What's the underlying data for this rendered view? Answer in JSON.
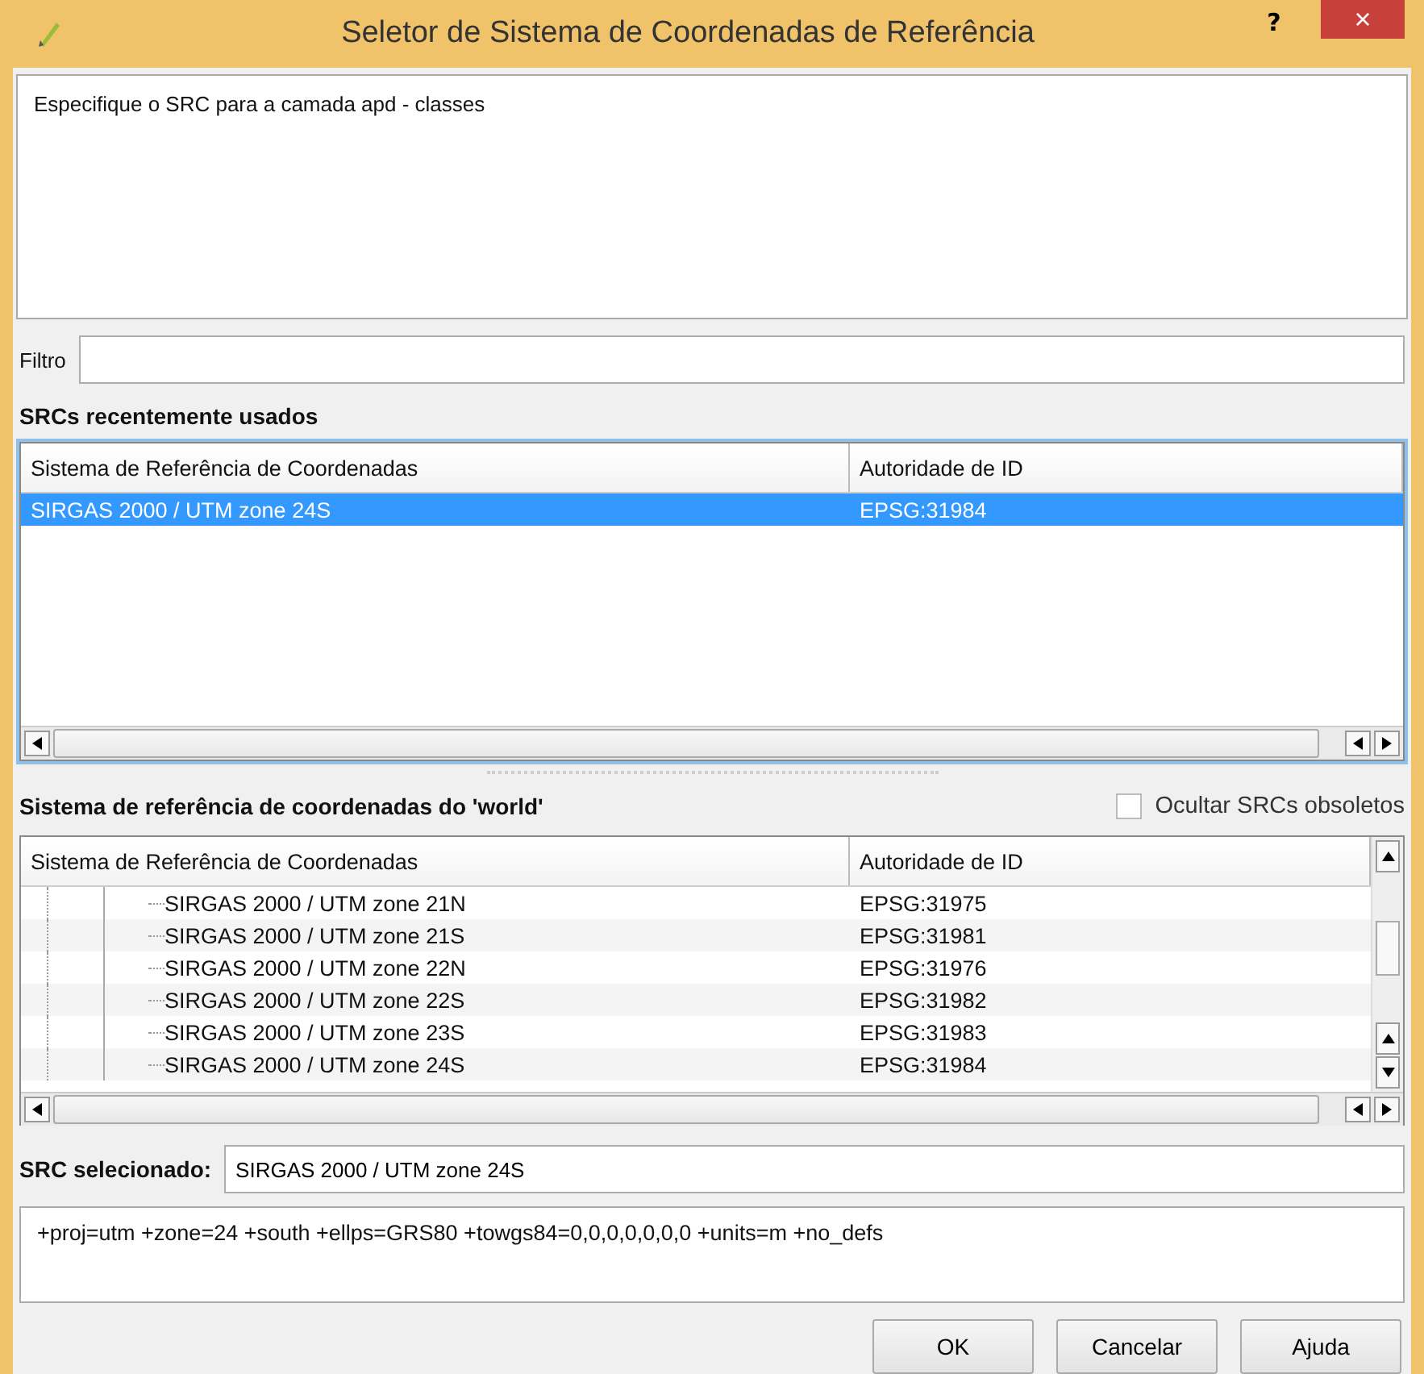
{
  "window": {
    "title": "Seletor de Sistema de Coordenadas de Referência",
    "help": "?",
    "close": "×"
  },
  "description": "Especifique o SRC para a camada apd - classes",
  "filter": {
    "label": "Filtro"
  },
  "recent": {
    "heading": "SRCs recentemente usados",
    "columns": [
      "Sistema de Referência de Coordenadas",
      "Autoridade de ID"
    ],
    "rows": [
      {
        "name": "SIRGAS 2000 / UTM zone 24S",
        "id": "EPSG:31984",
        "selected": true
      }
    ]
  },
  "world": {
    "heading": "Sistema de referência de coordenadas do 'world'",
    "hide_deprecated": {
      "label": "Ocultar SRCs obsoletos",
      "checked": false
    },
    "columns": [
      "Sistema de Referência de Coordenadas",
      "Autoridade de ID"
    ],
    "rows": [
      {
        "name": "SIRGAS 2000 / UTM zone 21N",
        "id": "EPSG:31975",
        "selected": false
      },
      {
        "name": "SIRGAS 2000 / UTM zone 21S",
        "id": "EPSG:31981",
        "selected": false
      },
      {
        "name": "SIRGAS 2000 / UTM zone 22N",
        "id": "EPSG:31976",
        "selected": false
      },
      {
        "name": "SIRGAS 2000 / UTM zone 22S",
        "id": "EPSG:31982",
        "selected": false
      },
      {
        "name": "SIRGAS 2000 / UTM zone 23S",
        "id": "EPSG:31983",
        "selected": false
      },
      {
        "name": "SIRGAS 2000 / UTM zone 24S",
        "id": "EPSG:31984",
        "selected": false
      }
    ]
  },
  "selected_crs": {
    "label": "SRC selecionado:",
    "value": "SIRGAS 2000 / UTM zone 24S"
  },
  "proj_string": "+proj=utm +zone=24 +south +ellps=GRS80 +towgs84=0,0,0,0,0,0,0 +units=m +no_defs",
  "buttons": [
    "OK",
    "Cancelar",
    "Ajuda"
  ]
}
